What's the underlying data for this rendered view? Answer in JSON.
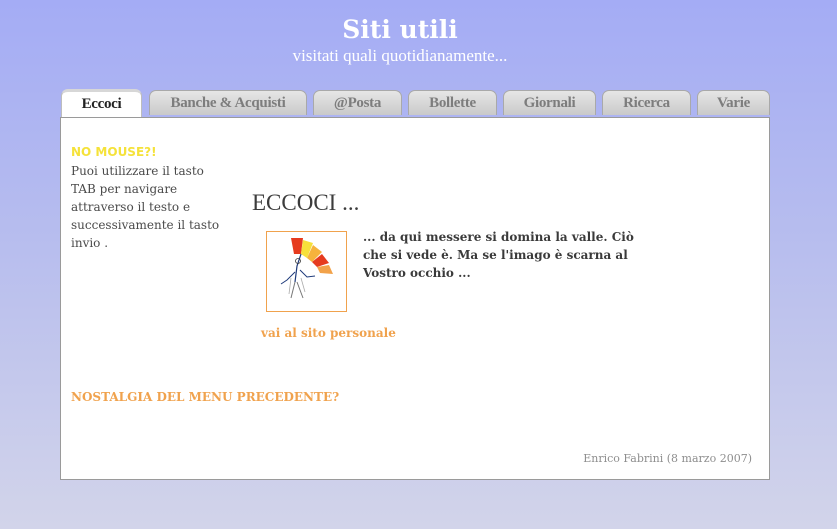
{
  "header": {
    "title": "Siti utili",
    "subtitle": "visitati quali quotidianamente..."
  },
  "tabs": [
    {
      "label": "Eccoci",
      "active": true
    },
    {
      "label": "Banche & Acquisti",
      "active": false
    },
    {
      "label": "@Posta",
      "active": false
    },
    {
      "label": "Bollette",
      "active": false
    },
    {
      "label": "Giornali",
      "active": false
    },
    {
      "label": "Ricerca",
      "active": false
    },
    {
      "label": "Varie",
      "active": false
    }
  ],
  "sidebar": {
    "title": "NO MOUSE?!",
    "text": "Puoi utilizzare il tasto TAB per navigare attraverso il testo e successivamente il tasto invio ."
  },
  "main": {
    "heading": "ECCOCI ...",
    "intro": "... da qui messere si domina la valle. Ciò che si vede è. Ma se l'imago è scarna al Vostro occhio ...",
    "personal_link": "vai al sito personale",
    "nostalgia_link": "NOSTALGIA DEL MENU PRECEDENTE?",
    "credit": "Enrico Fabrini (8 marzo 2007)"
  },
  "colors": {
    "accent_orange": "#f0a24d",
    "warning_yellow": "#f5e23a",
    "background_top": "#a4acf5"
  },
  "icons": {
    "photo": "juggler-fan-illustration"
  }
}
